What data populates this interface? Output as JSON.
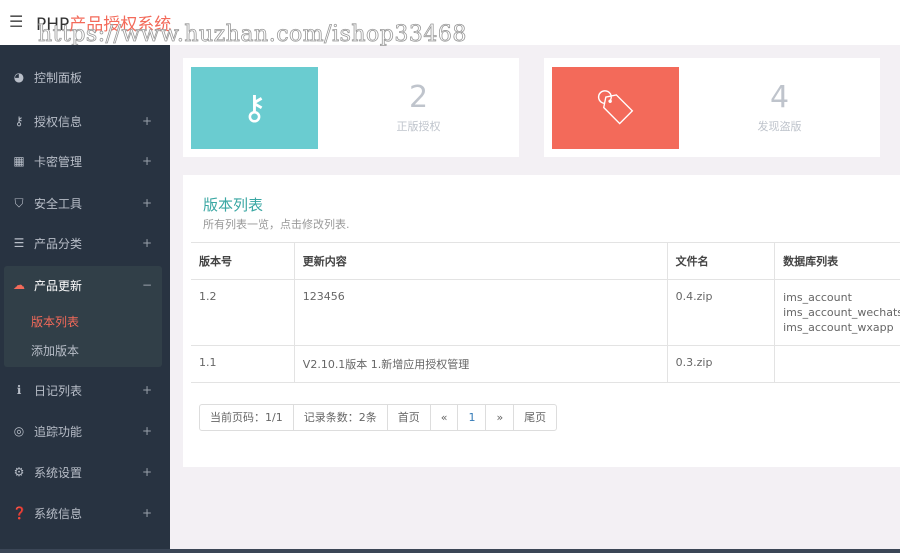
{
  "header": {
    "brand_prefix": "PHP",
    "brand_suffix": "产品授权系统",
    "watermark": "https://www.huzhan.com/ishop33468"
  },
  "sidebar": {
    "items": [
      {
        "label": "控制面板",
        "icon": "dashboard-icon",
        "expand": ""
      },
      {
        "label": "授权信息",
        "icon": "key-icon",
        "expand": "+"
      },
      {
        "label": "卡密管理",
        "icon": "qrcode-icon",
        "expand": "+"
      },
      {
        "label": "安全工具",
        "icon": "shield-icon",
        "expand": "+"
      },
      {
        "label": "产品分类",
        "icon": "list-icon",
        "expand": "+"
      },
      {
        "label": "产品更新",
        "icon": "cloud-upload-icon",
        "expand": "−"
      },
      {
        "label": "日记列表",
        "icon": "info-icon",
        "expand": "+"
      },
      {
        "label": "追踪功能",
        "icon": "target-icon",
        "expand": "+"
      },
      {
        "label": "系统设置",
        "icon": "gears-icon",
        "expand": "+"
      },
      {
        "label": "系统信息",
        "icon": "question-icon",
        "expand": "+"
      }
    ],
    "subitems": [
      {
        "label": "版本列表",
        "active": true
      },
      {
        "label": "添加版本",
        "active": false
      }
    ]
  },
  "stats": [
    {
      "value": "2",
      "label": "正版授权",
      "color": "#6accd0",
      "icon": "key-icon"
    },
    {
      "value": "4",
      "label": "发现盗版",
      "color": "#f36a5a",
      "icon": "tags-icon"
    }
  ],
  "panel": {
    "title": "版本列表",
    "subtitle": "所有列表一览，点击修改列表.",
    "columns": [
      "版本号",
      "更新内容",
      "文件名",
      "数据库列表"
    ],
    "rows": [
      {
        "version": "1.2",
        "content": "123456",
        "file": "0.4.zip",
        "db": [
          "ims_account",
          "ims_account_wechats",
          "ims_account_wxapp"
        ]
      },
      {
        "version": "1.1",
        "content": "V2.10.1版本 1.新增应用授权管理",
        "file": "0.3.zip",
        "db": []
      }
    ]
  },
  "pager": {
    "current": "当前页码：1/1",
    "count": "记录条数：2条",
    "first": "首页",
    "prev": "«",
    "page": "1",
    "next": "»",
    "last": "尾页"
  }
}
